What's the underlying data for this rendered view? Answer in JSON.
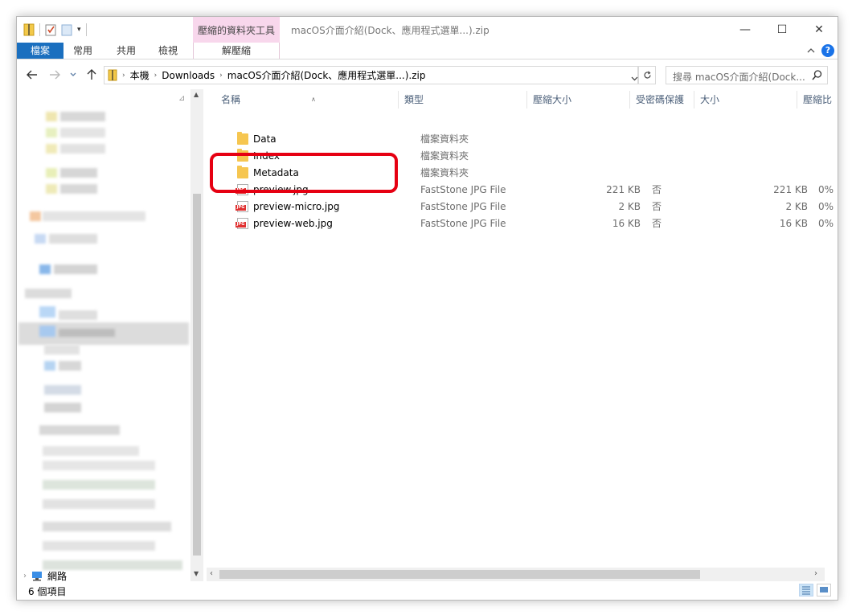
{
  "title_bar": {
    "context_tab_header": "壓縮的資料夾工具",
    "window_title": "macOS介面介紹(Dock、應用程式選單...).zip",
    "minimize": "—",
    "maximize": "☐",
    "close": "✕"
  },
  "ribbon": {
    "file": "檔案",
    "home": "常用",
    "share": "共用",
    "view": "檢視",
    "extract": "解壓縮",
    "help": "?"
  },
  "address": {
    "crumbs": [
      "本機",
      "Downloads",
      "macOS介面介紹(Dock、應用程式選單...).zip"
    ],
    "search_placeholder": "搜尋 macOS介面介紹(Dock..."
  },
  "columns": {
    "name": "名稱",
    "type": "類型",
    "compressed_size": "壓縮大小",
    "password": "受密碼保護",
    "size": "大小",
    "ratio": "壓縮比"
  },
  "files": [
    {
      "name": "Data",
      "type": "檔案資料夾",
      "compressed": "",
      "password": "",
      "size": "",
      "ratio": "",
      "icon": "folder-icon"
    },
    {
      "name": "Index",
      "type": "檔案資料夾",
      "compressed": "",
      "password": "",
      "size": "",
      "ratio": "",
      "icon": "folder-icon"
    },
    {
      "name": "Metadata",
      "type": "檔案資料夾",
      "compressed": "",
      "password": "",
      "size": "",
      "ratio": "",
      "icon": "folder-icon"
    },
    {
      "name": "preview.jpg",
      "type": "FastStone JPG File",
      "compressed": "221 KB",
      "password": "否",
      "size": "221 KB",
      "ratio": "0%",
      "icon": "jpg-icon"
    },
    {
      "name": "preview-micro.jpg",
      "type": "FastStone JPG File",
      "compressed": "2 KB",
      "password": "否",
      "size": "2 KB",
      "ratio": "0%",
      "icon": "jpg-icon"
    },
    {
      "name": "preview-web.jpg",
      "type": "FastStone JPG File",
      "compressed": "16 KB",
      "password": "否",
      "size": "16 KB",
      "ratio": "0%",
      "icon": "jpg-icon"
    }
  ],
  "nav": {
    "network": "網路"
  },
  "status": {
    "item_count": "6 個項目"
  },
  "colors": {
    "file_tab": "#1a6fbf",
    "context_tab": "#f8d7ec",
    "highlight": "#e60012",
    "header_text": "#4c607a"
  }
}
